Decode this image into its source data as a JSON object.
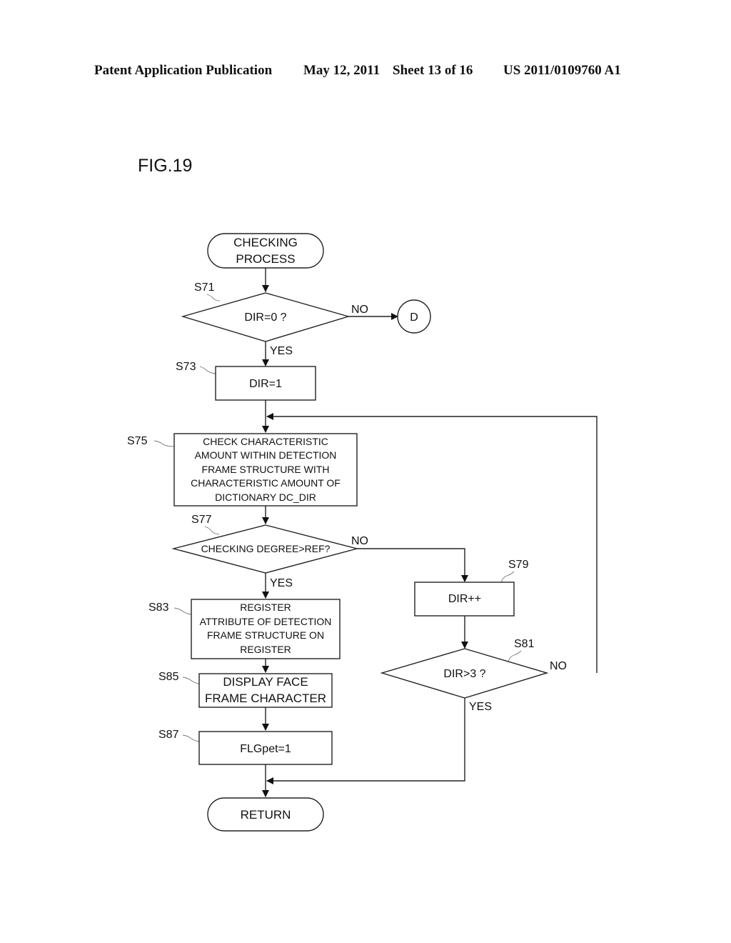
{
  "header": {
    "publication": "Patent Application Publication",
    "date": "May 12, 2011",
    "sheet": "Sheet 13 of 16",
    "number": "US 2011/0109760 A1"
  },
  "figure": {
    "label": "FIG.19"
  },
  "flowchart": {
    "start": {
      "lines": [
        "CHECKING",
        "PROCESS"
      ]
    },
    "s71": {
      "step": "S71",
      "text": "DIR=0 ?",
      "no": "NO",
      "yes": "YES"
    },
    "connector_d": {
      "text": "D"
    },
    "s73": {
      "step": "S73",
      "text": "DIR=1"
    },
    "s75": {
      "step": "S75",
      "lines": [
        "CHECK CHARACTERISTIC",
        "AMOUNT WITHIN DETECTION",
        "FRAME STRUCTURE WITH",
        "CHARACTERISTIC AMOUNT OF",
        "DICTIONARY DC_DIR"
      ]
    },
    "s77": {
      "step": "S77",
      "text": "CHECKING DEGREE>REF?",
      "no": "NO",
      "yes": "YES"
    },
    "s79": {
      "step": "S79",
      "text": "DIR++"
    },
    "s81": {
      "step": "S81",
      "text": "DIR>3 ?",
      "no": "NO",
      "yes": "YES"
    },
    "s83": {
      "step": "S83",
      "lines": [
        "REGISTER",
        "ATTRIBUTE OF DETECTION",
        "FRAME STRUCTURE ON",
        "REGISTER"
      ]
    },
    "s85": {
      "step": "S85",
      "lines": [
        "DISPLAY FACE",
        "FRAME CHARACTER"
      ]
    },
    "s87": {
      "step": "S87",
      "text": "FLGpet=1"
    },
    "end": {
      "text": "RETURN"
    }
  }
}
